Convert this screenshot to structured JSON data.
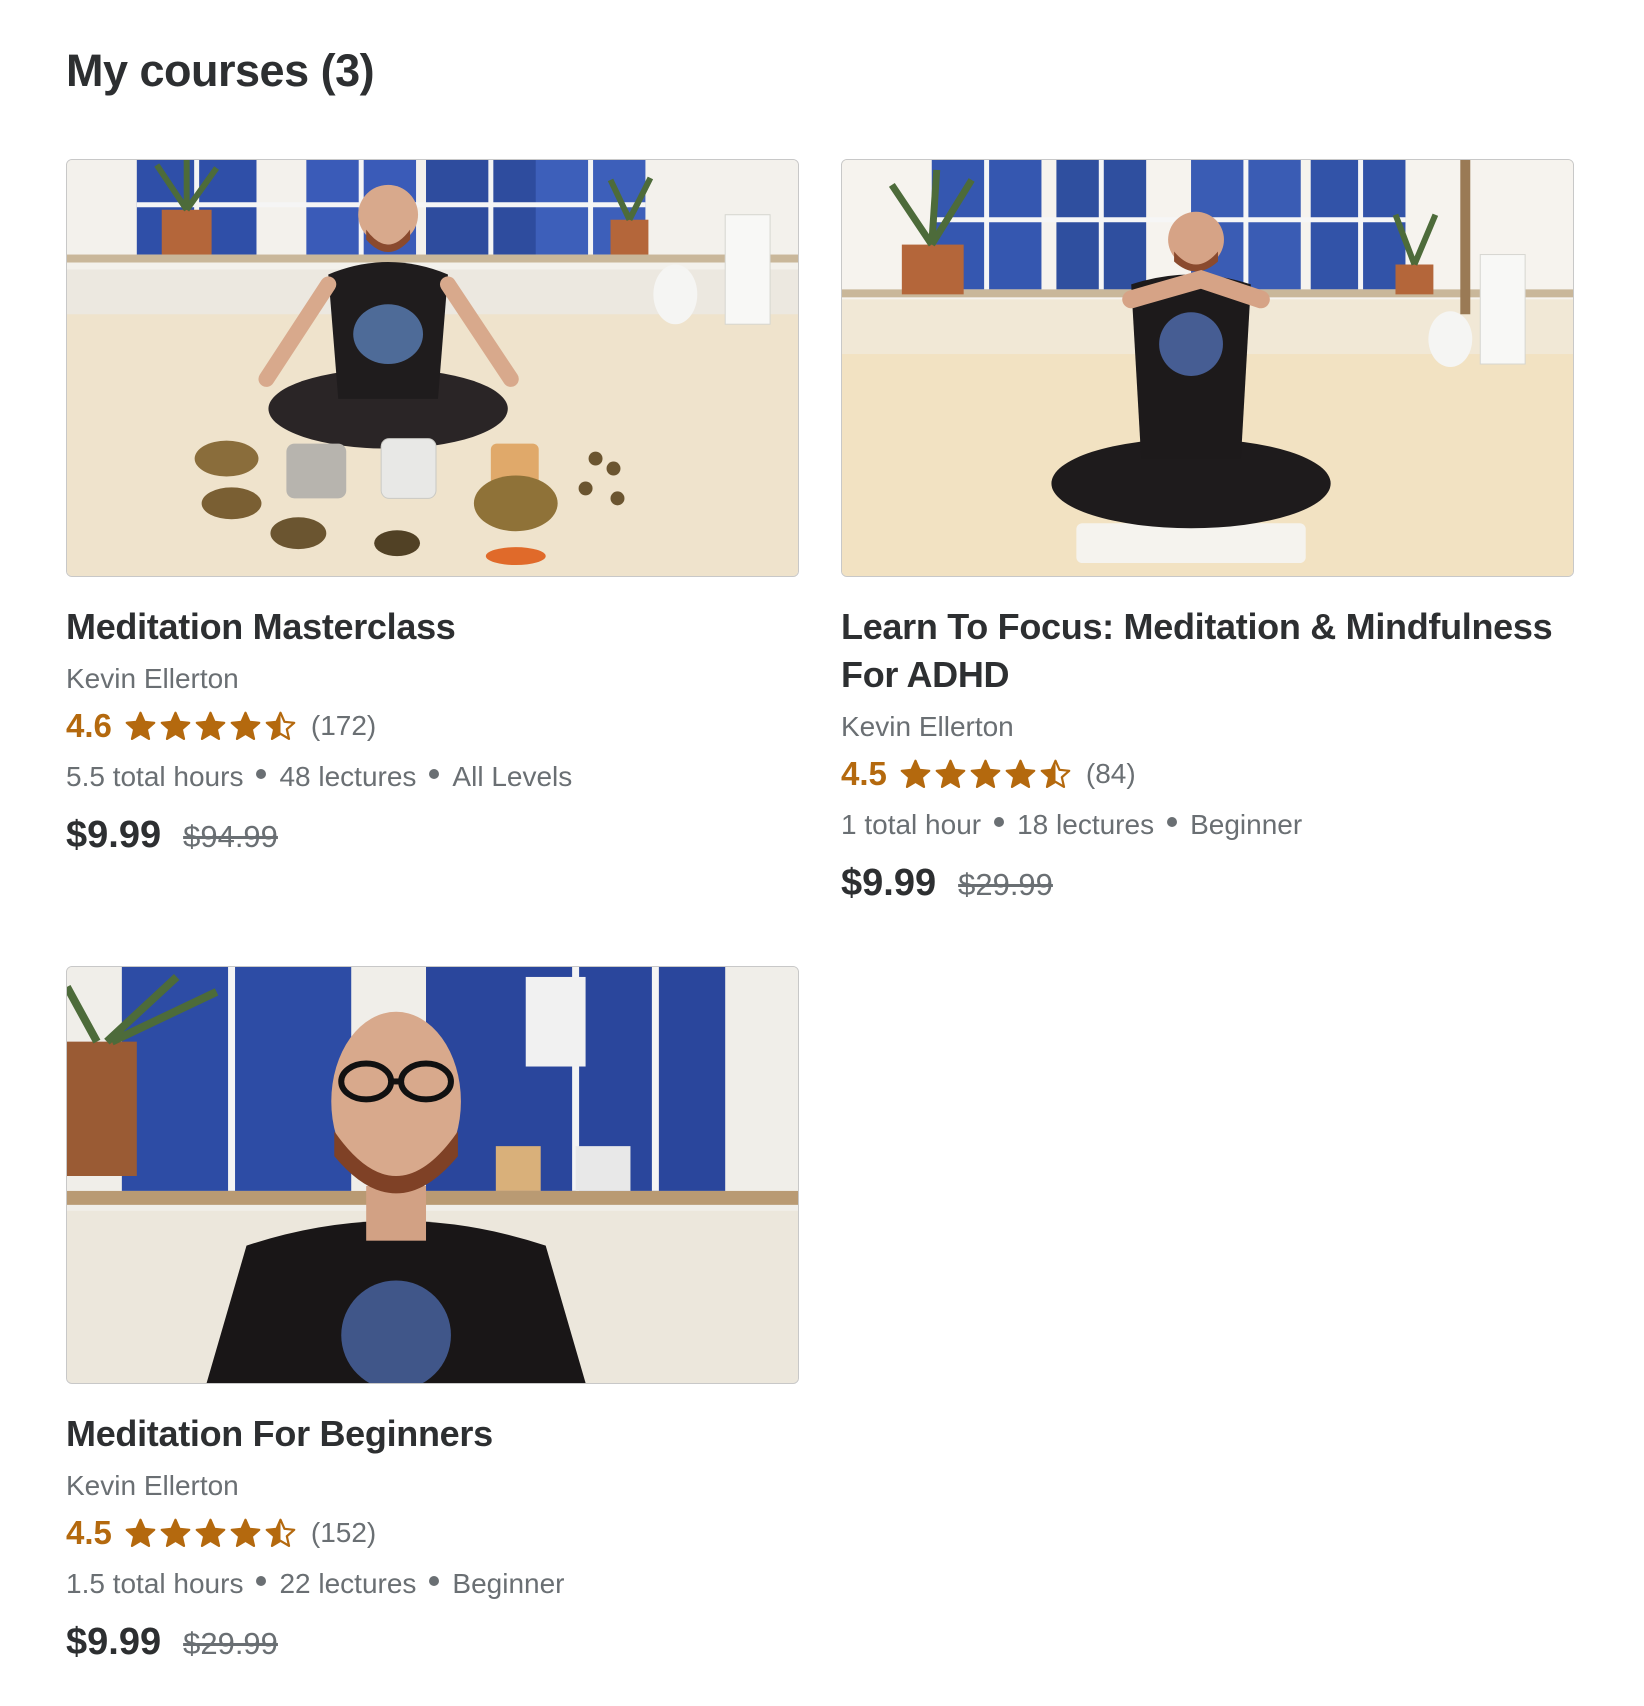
{
  "page": {
    "title": "My courses (3)"
  },
  "colors": {
    "rating": "#b4690e",
    "text_primary": "#2d2f31",
    "text_secondary": "#6a6f73"
  },
  "courses": [
    {
      "title": "Meditation Masterclass",
      "instructor": "Kevin Ellerton",
      "rating": "4.6",
      "rating_value": 4.6,
      "rating_count": "(172)",
      "hours": "5.5 total hours",
      "lectures": "48 lectures",
      "level": "All Levels",
      "price": "$9.99",
      "original_price": "$94.99",
      "thumbnail_icon": "course-thumbnail-image"
    },
    {
      "title": "Learn To Focus: Meditation & Mindfulness For ADHD",
      "instructor": "Kevin Ellerton",
      "rating": "4.5",
      "rating_value": 4.5,
      "rating_count": "(84)",
      "hours": "1 total hour",
      "lectures": "18 lectures",
      "level": "Beginner",
      "price": "$9.99",
      "original_price": "$29.99",
      "thumbnail_icon": "course-thumbnail-image"
    },
    {
      "title": "Meditation For Beginners",
      "instructor": "Kevin Ellerton",
      "rating": "4.5",
      "rating_value": 4.5,
      "rating_count": "(152)",
      "hours": "1.5 total hours",
      "lectures": "22 lectures",
      "level": "Beginner",
      "price": "$9.99",
      "original_price": "$29.99",
      "thumbnail_icon": "course-thumbnail-image"
    }
  ]
}
